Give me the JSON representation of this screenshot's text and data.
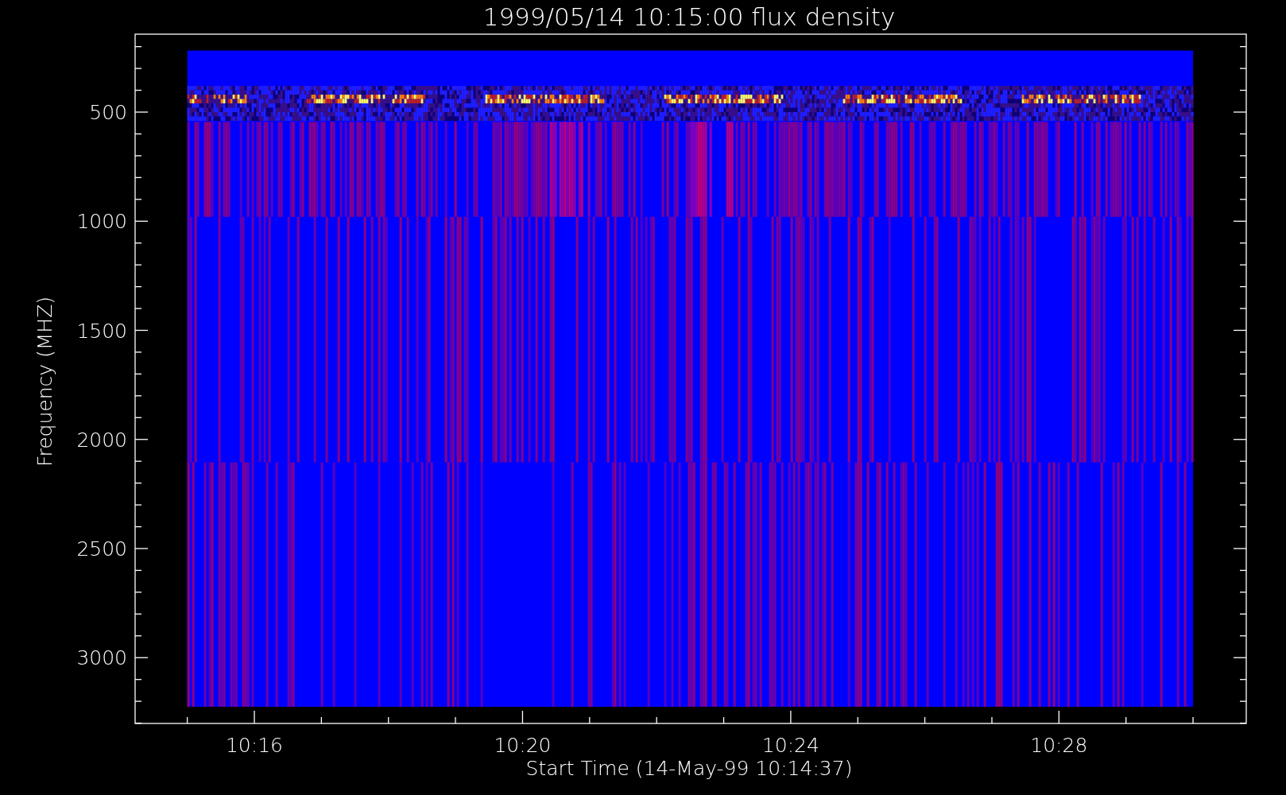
{
  "plot": {
    "title": "1999/05/14 10:15:00 flux density",
    "xlabel": "Start Time (14-May-99 10:14:37)",
    "ylabel": "Frequency (MHZ)",
    "xtick_labels": [
      "10:16",
      "10:20",
      "10:24",
      "10:28"
    ],
    "ytick_labels": [
      "500",
      "1000",
      "1500",
      "2000",
      "2500",
      "3000"
    ]
  }
}
